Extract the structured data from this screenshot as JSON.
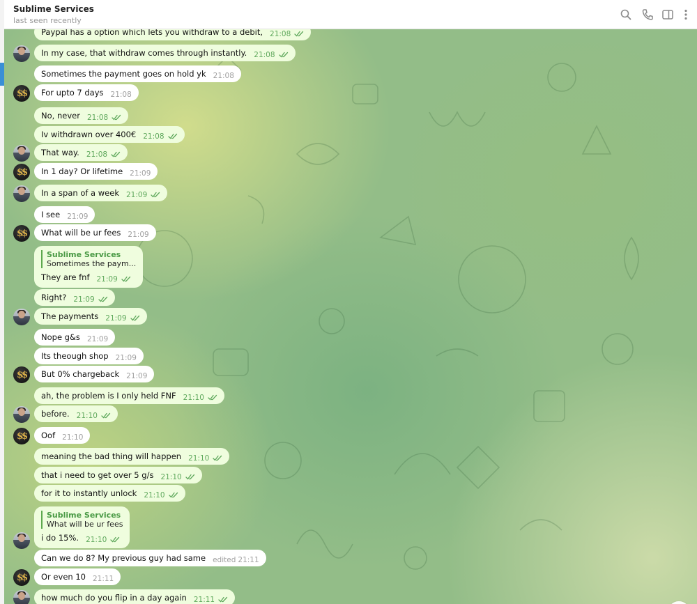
{
  "header": {
    "title": "Sublime Services",
    "status": "last seen recently",
    "icons": [
      "search-icon",
      "phone-icon",
      "sidebar-toggle-icon",
      "more-icon"
    ]
  },
  "colors": {
    "outgoing_bubble": "#effdde",
    "incoming_bubble": "#ffffff",
    "read_check": "#5fa85c",
    "reply_accent": "#4a9a45",
    "sidebar_accent": "#3a8fd6"
  },
  "messages": [
    {
      "text": "Paypal has a option which lets you withdraw to a debit,",
      "time": "21:08",
      "dir": "out"
    },
    {
      "text": "In my case, that withdraw comes through instantly.",
      "time": "21:08",
      "dir": "out"
    },
    {
      "text": "Sometimes the payment goes on hold yk",
      "time": "21:08",
      "dir": "in"
    },
    {
      "text": "For upto 7 days",
      "time": "21:08",
      "dir": "in"
    },
    {
      "text": "No, never",
      "time": "21:08",
      "dir": "out"
    },
    {
      "text": "Iv withdrawn over 400€",
      "time": "21:08",
      "dir": "out"
    },
    {
      "text": "That way.",
      "time": "21:08",
      "dir": "out"
    },
    {
      "text": "In 1 day? Or lifetime",
      "time": "21:09",
      "dir": "in"
    },
    {
      "text": "In a span of a week",
      "time": "21:09",
      "dir": "out"
    },
    {
      "text": "I see",
      "time": "21:09",
      "dir": "in"
    },
    {
      "text": "What will be ur fees",
      "time": "21:09",
      "dir": "in"
    },
    {
      "text": "They are fnf",
      "time": "21:09",
      "dir": "out",
      "reply_name": "Sublime Services",
      "reply_text": "Sometimes the paym..."
    },
    {
      "text": "Right?",
      "time": "21:09",
      "dir": "out"
    },
    {
      "text": "The payments",
      "time": "21:09",
      "dir": "out"
    },
    {
      "text": "Nope g&s",
      "time": "21:09",
      "dir": "in"
    },
    {
      "text": "Its theough shop",
      "time": "21:09",
      "dir": "in"
    },
    {
      "text": "But 0% chargeback",
      "time": "21:09",
      "dir": "in"
    },
    {
      "text": "ah, the problem is I only held FNF",
      "time": "21:10",
      "dir": "out"
    },
    {
      "text": "before.",
      "time": "21:10",
      "dir": "out"
    },
    {
      "text": "Oof",
      "time": "21:10",
      "dir": "in"
    },
    {
      "text": "meaning the bad thing will happen",
      "time": "21:10",
      "dir": "out"
    },
    {
      "text": "that i need to get over 5 g/s",
      "time": "21:10",
      "dir": "out"
    },
    {
      "text": "for it to instantly unlock",
      "time": "21:10",
      "dir": "out"
    },
    {
      "text": "i do 15%.",
      "time": "21:10",
      "dir": "out",
      "reply_name": "Sublime Services",
      "reply_text": "What will be ur fees"
    },
    {
      "text": "Can we do 8? My previous guy had same",
      "time": "21:11",
      "dir": "in",
      "edited": "edited"
    },
    {
      "text": "Or even 10",
      "time": "21:11",
      "dir": "in"
    },
    {
      "text": "how much do you flip in a day again",
      "time": "21:11",
      "dir": "out"
    }
  ]
}
